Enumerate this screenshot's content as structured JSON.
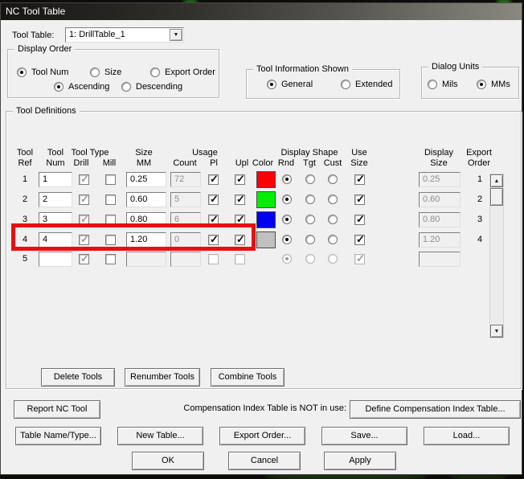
{
  "window": {
    "title": "NC Tool Table"
  },
  "tool_table": {
    "label": "Tool Table:",
    "value": "1: DrillTable_1"
  },
  "icons": {
    "dropdown_arrow": "▼",
    "scroll_up": "▲",
    "scroll_down": "▼",
    "check": "✓"
  },
  "display_order": {
    "title": "Display Order",
    "row1": [
      {
        "label": "Tool Num",
        "selected": true
      },
      {
        "label": "Size",
        "selected": false
      },
      {
        "label": "Export Order",
        "selected": false
      }
    ],
    "row2": [
      {
        "label": "Ascending",
        "selected": true
      },
      {
        "label": "Descending",
        "selected": false
      }
    ]
  },
  "tool_information": {
    "title": "Tool Information Shown",
    "options": [
      {
        "label": "General",
        "selected": true
      },
      {
        "label": "Extended",
        "selected": false
      }
    ]
  },
  "dialog_units": {
    "title": "Dialog Units",
    "options": [
      {
        "label": "Mils",
        "selected": false
      },
      {
        "label": "MMs",
        "selected": true
      }
    ]
  },
  "tool_definitions": {
    "title": "Tool Definitions",
    "headers": {
      "tool_ref": [
        "Tool",
        "Ref"
      ],
      "tool_num": [
        "Tool",
        "Num"
      ],
      "tool_type": "Tool Type",
      "drill": "Drill",
      "mill": "Mill",
      "size_mm": [
        "Size",
        "MM"
      ],
      "usage": "Usage",
      "count": "Count",
      "pl": "Pl",
      "upl": "Upl",
      "color": "Color",
      "display_shape": "Display Shape",
      "rnd": "Rnd",
      "tgt": "Tgt",
      "cust": "Cust",
      "use_size": [
        "Use",
        "Size"
      ],
      "display_size": [
        "Display",
        "Size"
      ],
      "export_order": [
        "Export",
        "Order"
      ]
    },
    "rows": [
      {
        "ref": "1",
        "num": "1",
        "drill": true,
        "mill": false,
        "size": "0.25",
        "count": "72",
        "pl": true,
        "upl": true,
        "color": "#ff0000",
        "rnd": true,
        "tgt": false,
        "cust": false,
        "use_size": true,
        "display_size": "0.25",
        "export": "1",
        "highlighted": false
      },
      {
        "ref": "2",
        "num": "2",
        "drill": true,
        "mill": false,
        "size": "0.60",
        "count": "5",
        "pl": true,
        "upl": true,
        "color": "#00ee00",
        "rnd": true,
        "tgt": false,
        "cust": false,
        "use_size": true,
        "display_size": "0.60",
        "export": "2",
        "highlighted": false
      },
      {
        "ref": "3",
        "num": "3",
        "drill": true,
        "mill": false,
        "size": "0.80",
        "count": "6",
        "pl": true,
        "upl": true,
        "color": "#0000ee",
        "rnd": true,
        "tgt": false,
        "cust": false,
        "use_size": true,
        "display_size": "0.80",
        "export": "3",
        "highlighted": false
      },
      {
        "ref": "4",
        "num": "4",
        "drill": true,
        "mill": false,
        "size": "1.20",
        "count": "0",
        "pl": true,
        "upl": true,
        "color": "#c0c0c0",
        "rnd": true,
        "tgt": false,
        "cust": false,
        "use_size": true,
        "display_size": "1.20",
        "export": "4",
        "highlighted": true
      },
      {
        "ref": "5",
        "num": "",
        "drill": true,
        "mill": false,
        "size": "",
        "count": "",
        "pl": false,
        "upl": false,
        "color": null,
        "rnd": true,
        "tgt": false,
        "cust": false,
        "use_size": true,
        "display_size": "",
        "export": "",
        "highlighted": false,
        "disabled": true
      }
    ],
    "buttons": {
      "delete": "Delete Tools",
      "renumber": "Renumber Tools",
      "combine": "Combine Tools"
    }
  },
  "compensation": {
    "report_button": "Report NC Tool",
    "status_text": "Compensation Index Table is NOT in use:",
    "define_button": "Define Compensation Index Table..."
  },
  "table_buttons": {
    "name_type": "Table Name/Type...",
    "new_table": "New Table...",
    "export_order": "Export Order...",
    "save": "Save...",
    "load": "Load..."
  },
  "dialog_buttons": {
    "ok": "OK",
    "cancel": "Cancel",
    "apply": "Apply"
  },
  "highlight_color": "#e80f0f"
}
